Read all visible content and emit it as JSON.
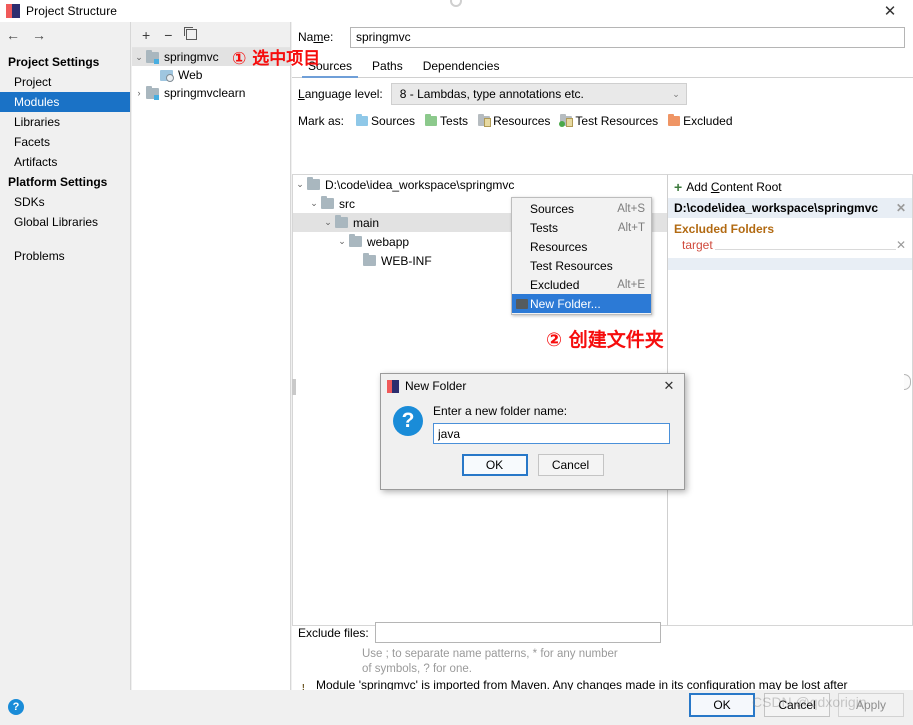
{
  "window": {
    "title": "Project Structure",
    "close_label": "✕",
    "app_icon": "intellij-idea-icon"
  },
  "nav": {
    "back_label": "←",
    "forward_label": "→",
    "sections": [
      {
        "type": "group",
        "label": "Project Settings"
      },
      {
        "type": "item",
        "label": "Project",
        "selected": false
      },
      {
        "type": "item",
        "label": "Modules",
        "selected": true
      },
      {
        "type": "item",
        "label": "Libraries",
        "selected": false
      },
      {
        "type": "item",
        "label": "Facets",
        "selected": false
      },
      {
        "type": "item",
        "label": "Artifacts",
        "selected": false
      },
      {
        "type": "group",
        "label": "Platform Settings"
      },
      {
        "type": "item",
        "label": "SDKs",
        "selected": false
      },
      {
        "type": "item",
        "label": "Global Libraries",
        "selected": false
      },
      {
        "type": "item",
        "label": "Problems",
        "selected": false
      }
    ],
    "labels": {
      "project_settings": "Project Settings",
      "project": "Project",
      "modules": "Modules",
      "libraries": "Libraries",
      "facets": "Facets",
      "artifacts": "Artifacts",
      "platform_settings": "Platform Settings",
      "sdks": "SDKs",
      "global_libraries": "Global Libraries",
      "problems": "Problems"
    }
  },
  "modules_panel": {
    "toolbar": {
      "add_label": "+",
      "remove_label": "−",
      "copy_label": "copy-icon"
    },
    "tree": [
      {
        "label": "springmvc",
        "twisty": "⌄",
        "depth": 0,
        "selected": true,
        "icon": "module-folder-icon"
      },
      {
        "label": "Web",
        "twisty": "",
        "depth": 1,
        "selected": false,
        "icon": "web-facet-icon"
      },
      {
        "label": "springmvclearn",
        "twisty": "›",
        "depth": 0,
        "selected": false,
        "icon": "module-folder-icon"
      }
    ]
  },
  "main": {
    "name_label": "Name:",
    "name_value": "springmvc",
    "tabs": [
      {
        "label": "Sources",
        "active": true
      },
      {
        "label": "Paths",
        "active": false
      },
      {
        "label": "Dependencies",
        "active": false
      }
    ],
    "language_level": {
      "label": "Language level:",
      "value": "8 - Lambdas, type annotations etc.",
      "chevron": "⌄"
    },
    "mark_as": {
      "label": "Mark as:",
      "items": [
        {
          "label": "Sources",
          "color": "#8fc8e8",
          "swatch": "blue"
        },
        {
          "label": "Tests",
          "color": "#8cc98c",
          "swatch": "green"
        },
        {
          "label": "Resources",
          "color": "#b6bcc0",
          "swatch": "gray"
        },
        {
          "label": "Test Resources",
          "color": "#b6bcc0",
          "swatch": "testres"
        },
        {
          "label": "Excluded",
          "color": "#ef9565",
          "swatch": "orange"
        }
      ]
    },
    "file_tree": [
      {
        "label": "D:\\code\\idea_workspace\\springmvc",
        "twisty": "⌄",
        "depth": 0,
        "selected": false
      },
      {
        "label": "src",
        "twisty": "⌄",
        "depth": 1,
        "selected": false
      },
      {
        "label": "main",
        "twisty": "⌄",
        "depth": 2,
        "selected": true
      },
      {
        "label": "webapp",
        "twisty": "⌄",
        "depth": 3,
        "selected": false
      },
      {
        "label": "WEB-INF",
        "twisty": "",
        "depth": 4,
        "selected": false
      }
    ],
    "content_roots": {
      "add_label": "Add Content Root",
      "add_plus": "+",
      "root_path": "D:\\code\\idea_workspace\\springmvc",
      "excluded_header": "Excluded Folders",
      "excluded_items": [
        "target"
      ],
      "remove_label": "✕"
    },
    "exclude_files": {
      "label": "Exclude files:",
      "value": "",
      "hint": "Use ; to separate name patterns, * for any number of symbols, ? for one."
    },
    "warning": {
      "text": "Module 'springmvc' is imported from Maven. Any changes made in its configuration may be lost after reimporting.",
      "icon": "warning-triangle-icon"
    }
  },
  "context_menu": {
    "items": [
      {
        "label": "Sources",
        "shortcut": "Alt+S",
        "active": false
      },
      {
        "label": "Tests",
        "shortcut": "Alt+T",
        "active": false
      },
      {
        "label": "Resources",
        "shortcut": "",
        "active": false
      },
      {
        "label": "Test Resources",
        "shortcut": "",
        "active": false
      },
      {
        "label": "Excluded",
        "shortcut": "Alt+E",
        "active": false
      },
      {
        "label": "New Folder...",
        "shortcut": "",
        "active": true
      }
    ]
  },
  "new_folder_dialog": {
    "title": "New Folder",
    "close_label": "✕",
    "prompt": "Enter a new folder name:",
    "input_value": "java",
    "ok_label": "OK",
    "cancel_label": "Cancel",
    "icon": "question-mark-icon"
  },
  "footer": {
    "help_label": "?",
    "ok_label": "OK",
    "cancel_label": "Cancel",
    "apply_label": "Apply"
  },
  "annotations": [
    {
      "id": "anno-1",
      "text": "① 选中项目",
      "color": "#f60d0d"
    },
    {
      "id": "anno-2",
      "text": "② 创建文件夹",
      "color": "#f60d0d"
    }
  ],
  "watermark": "CSDN @qdxorigin"
}
